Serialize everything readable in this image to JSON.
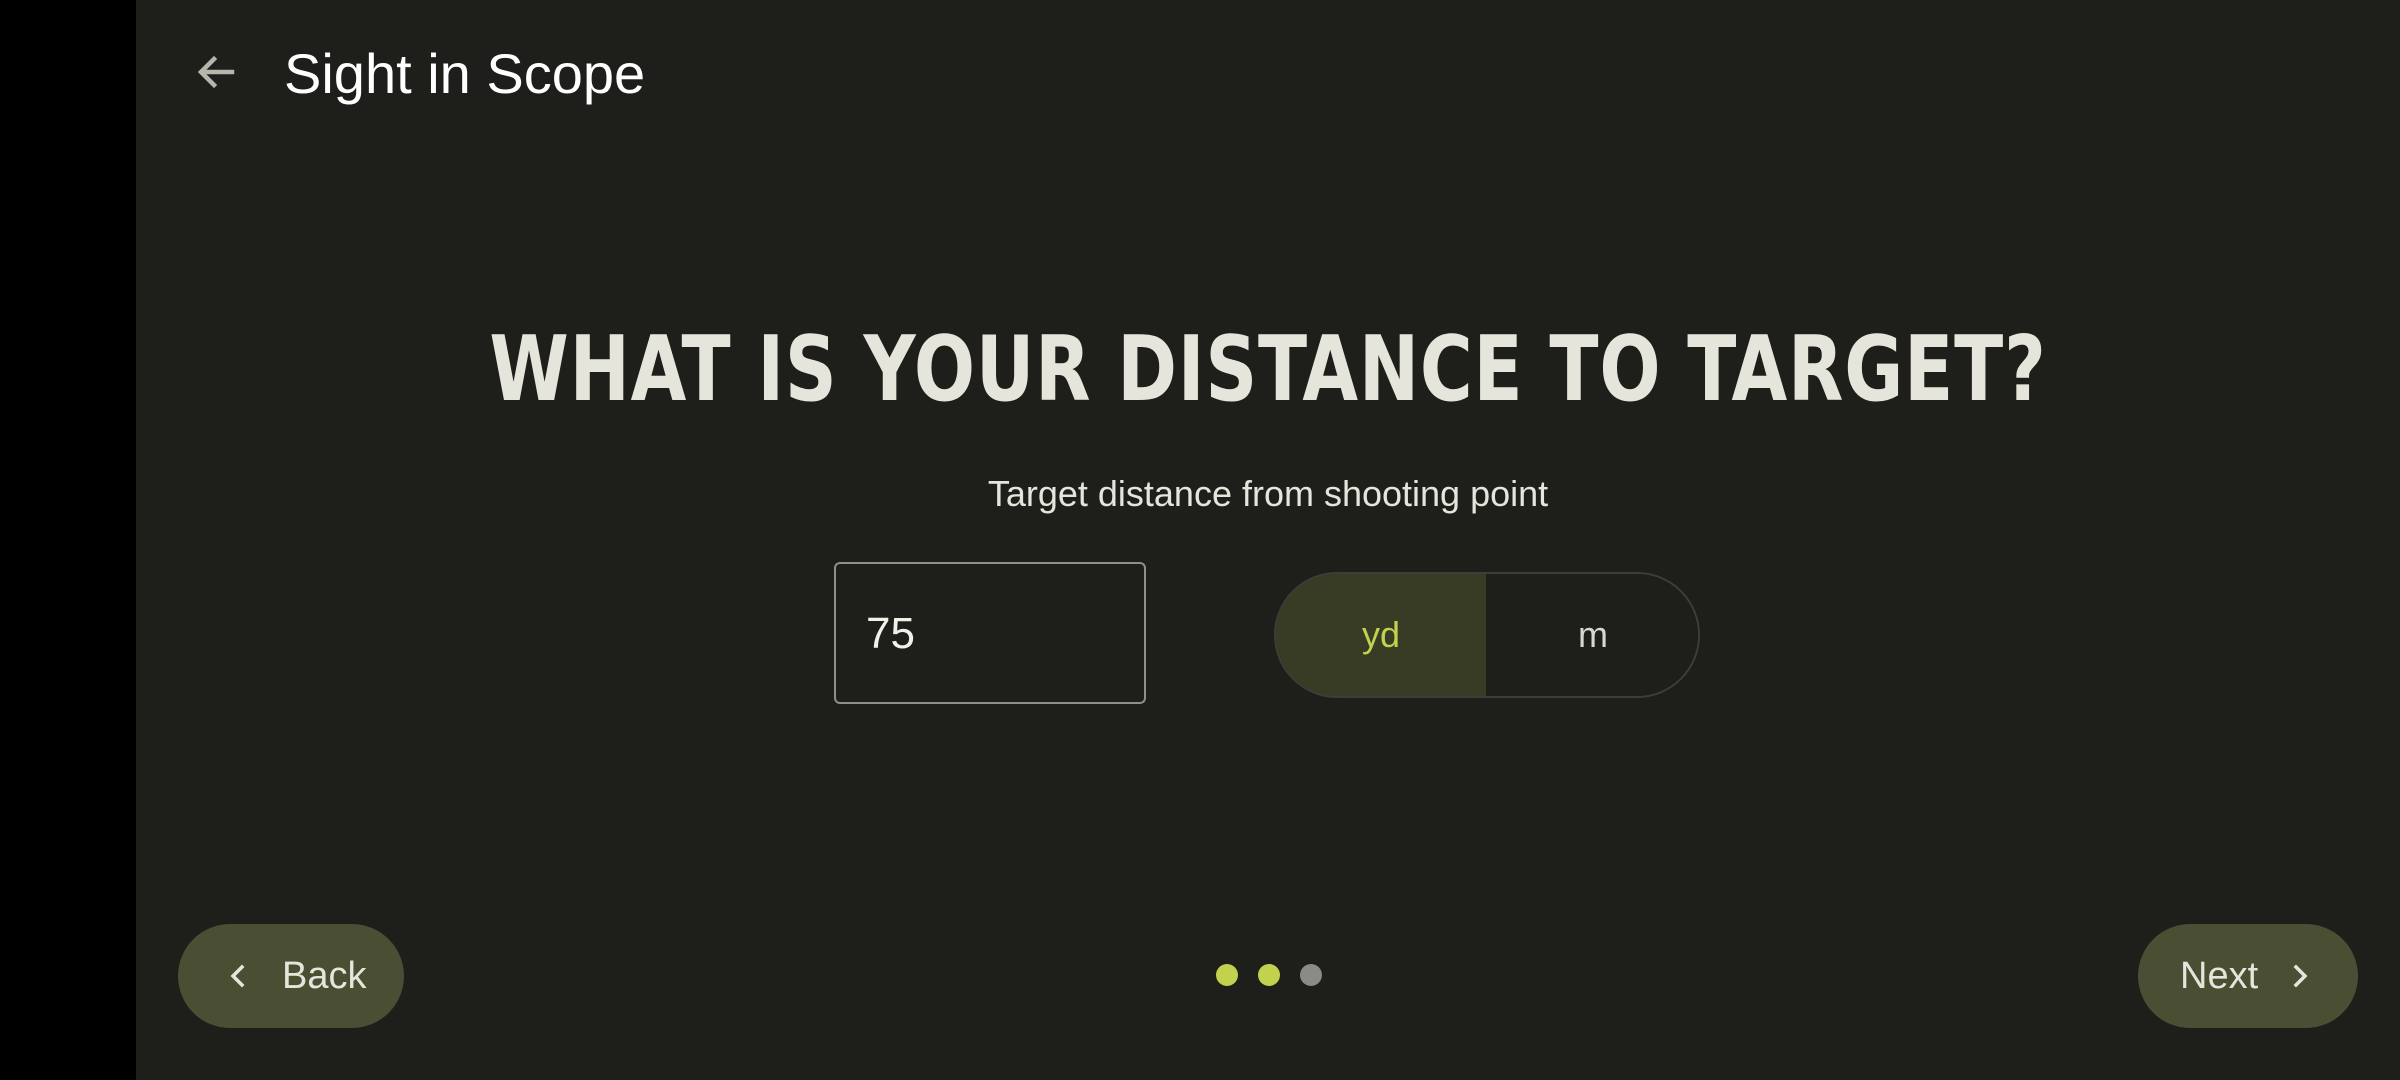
{
  "app_bar": {
    "title": "Sight in Scope",
    "back_icon": "arrow-left-icon"
  },
  "step": {
    "question": "WHAT IS YOUR DISTANCE TO TARGET?",
    "subtitle": "Target distance from shooting point",
    "distance_value": "75",
    "units": [
      {
        "label": "yd",
        "selected": true
      },
      {
        "label": "m",
        "selected": false
      }
    ]
  },
  "pager": {
    "total": 3,
    "active_count": 2,
    "active_color": "#c2d24f",
    "inactive_color": "#8a8b84"
  },
  "nav": {
    "back_label": "Back",
    "next_label": "Next"
  },
  "colors": {
    "background": "#1e1f1a",
    "accent": "#c2d24f",
    "button": "#4a4f33",
    "selected_segment": "#393c25"
  }
}
